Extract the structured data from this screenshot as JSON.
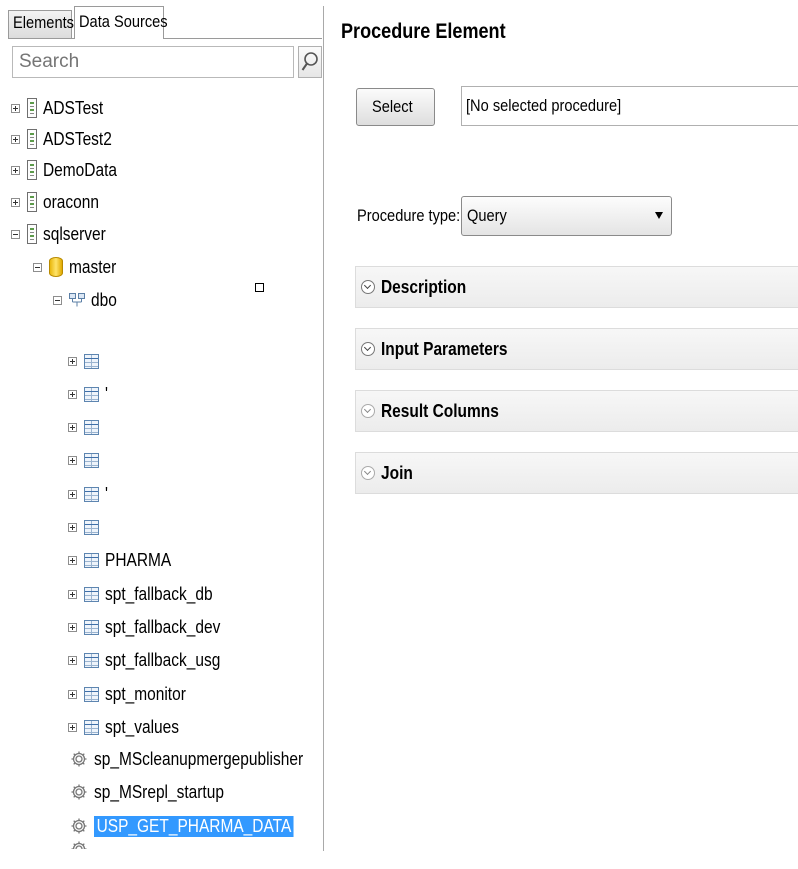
{
  "left_panel": {
    "tabs": [
      "Elements",
      "Data Sources"
    ],
    "search_placeholder": "Search",
    "tree": {
      "datasources": [
        "ADSTest",
        "ADSTest2",
        "DemoData",
        "oraconn",
        "sqlserver"
      ],
      "database": "master",
      "schema": "dbo",
      "tables": [
        "",
        "'",
        "",
        "",
        "'",
        "",
        "PHARMA",
        "spt_fallback_db",
        "spt_fallback_dev",
        "spt_fallback_usg",
        "spt_monitor",
        "spt_values"
      ],
      "procedures": [
        "sp_MScleanupmergepublisher",
        "sp_MSrepl_startup",
        "USP_GET_PHARMA_DATA"
      ],
      "selected_procedure": "USP_GET_PHARMA_DATA"
    }
  },
  "right_panel": {
    "title": "Procedure Element",
    "select_button": "Select",
    "selected_procedure_text": "[No selected procedure]",
    "procedure_type_label": "Procedure type:",
    "procedure_type_value": "Query",
    "sections": [
      "Description",
      "Input Parameters",
      "Result Columns",
      "Join"
    ]
  },
  "colors": {
    "selection": "#3399ff",
    "panel_border": "#a9a9a9"
  },
  "icons": {
    "search": "magnifier-icon",
    "datasource": "datasource-icon",
    "database": "database-cylinder-icon",
    "schema": "schema-icon",
    "table": "table-grid-icon",
    "procedure": "gear-icon",
    "section": "chevron-circle-icon",
    "dropdown": "dropdown-arrow-icon"
  }
}
